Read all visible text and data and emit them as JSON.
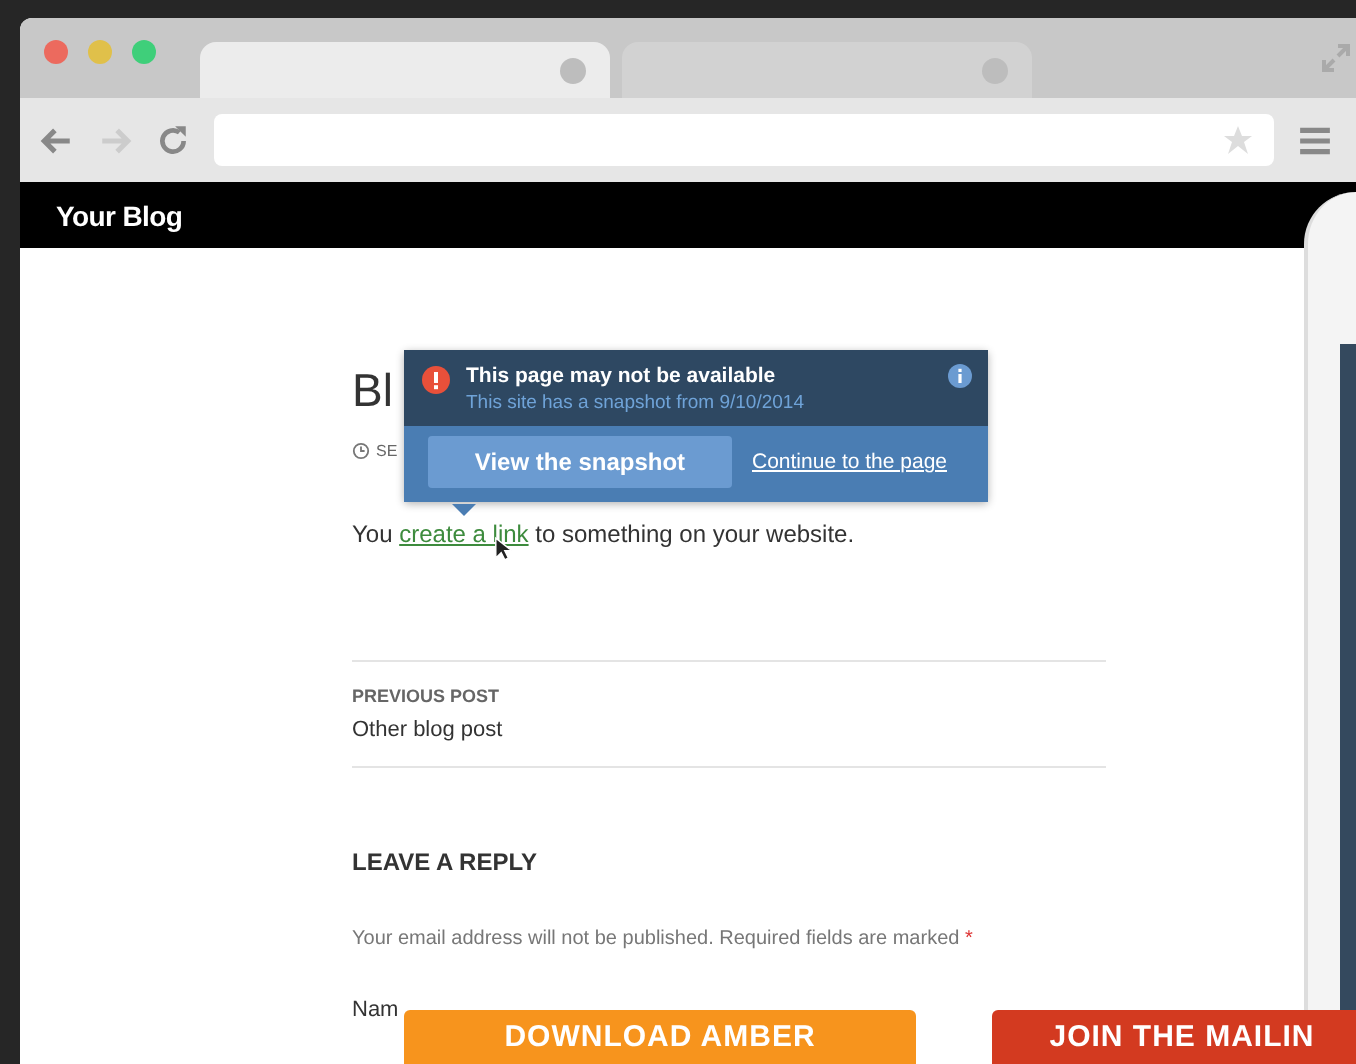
{
  "browser": {
    "tabs": [
      {
        "selected": true
      },
      {
        "selected": false
      }
    ]
  },
  "site": {
    "title": "Your Blog"
  },
  "post": {
    "title": "Bl",
    "meta": "SE",
    "body_before": "You ",
    "link": "create a link",
    "body_after": " to something on your website."
  },
  "popup": {
    "heading": "This page may not be available",
    "subtext": "This site has a snapshot from 9/10/2014",
    "primary_button": "View the snapshot",
    "link": "Continue to the page"
  },
  "post_navigation": {
    "label": "PREVIOUS POST",
    "title": "Other blog post"
  },
  "reply": {
    "heading": "LEAVE A REPLY",
    "note": "Your email address will not be published. Required fields are marked",
    "required_mark": "*",
    "name_label": "Nam"
  },
  "overlay_buttons": [
    {
      "label": "DOWNLOAD AMBER",
      "color": "#f7941d"
    },
    {
      "label": "JOIN THE MAILIN",
      "color": "#d33a20"
    }
  ]
}
